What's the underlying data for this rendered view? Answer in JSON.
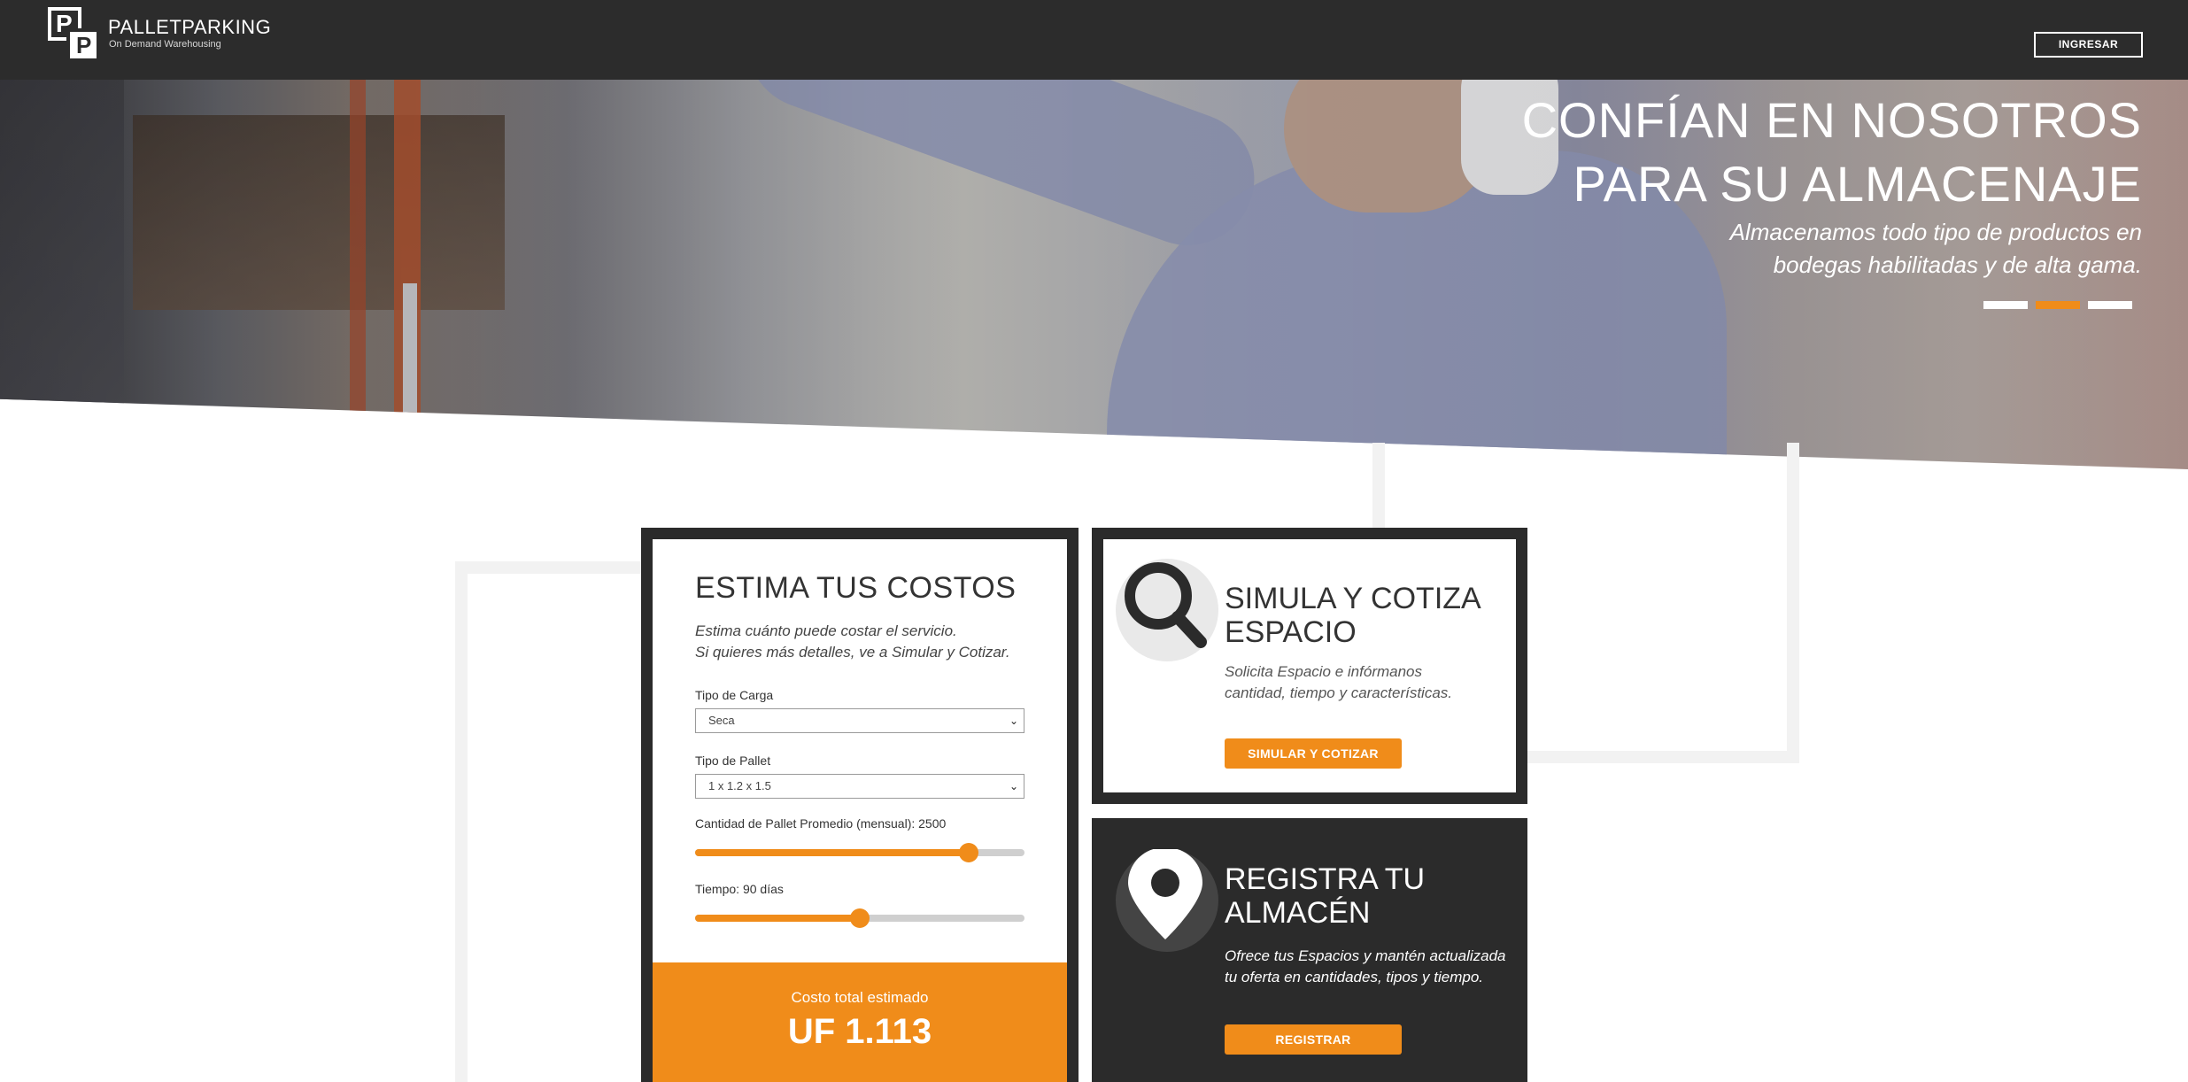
{
  "header": {
    "brand_name": "PALLETPARKING",
    "brand_tagline": "On Demand Warehousing",
    "logo_letters": [
      "P",
      "P"
    ],
    "login_label": "INGRESAR"
  },
  "hero": {
    "title_line1": "CONFÍAN EN NOSOTROS",
    "title_line2": "PARA SU ALMACENAJE",
    "subtitle_line1": "Almacenamos todo tipo de productos en",
    "subtitle_line2": "bodegas habilitadas y de alta gama.",
    "slides_total": 3,
    "active_slide": 2
  },
  "estimate": {
    "title": "ESTIMA TUS COSTOS",
    "desc_line1": "Estima cuánto puede costar el servicio.",
    "desc_line2": "Si quieres más detalles, ve a Simular y Cotizar.",
    "cargo_label": "Tipo de Carga",
    "cargo_value": "Seca",
    "pallet_label": "Tipo de Pallet",
    "pallet_value": "1 x 1.2 x 1.5",
    "quantity_label": "Cantidad de Pallet Promedio (mensual): 2500",
    "quantity_fraction": 0.83,
    "time_label": "Tiempo: 90 días",
    "time_fraction": 0.5,
    "result_label": "Costo total estimado",
    "result_value": "UF 1.113"
  },
  "simulate": {
    "icon": "search-icon",
    "title": "SIMULA Y COTIZA ESPACIO",
    "desc": "Solicita Espacio e infórmanos cantidad, tiempo y características.",
    "button_label": "SIMULAR Y COTIZAR"
  },
  "register": {
    "icon": "map-pin-icon",
    "title": "REGISTRA TU ALMACÉN",
    "desc": "Ofrece tus Espacios y mantén actualizada tu oferta en cantidades, tipos y tiempo.",
    "button_label": "REGISTRAR"
  },
  "colors": {
    "accent": "#f08c1a",
    "dark": "#2b2b2b",
    "header_bg": "#2c2c2c"
  }
}
